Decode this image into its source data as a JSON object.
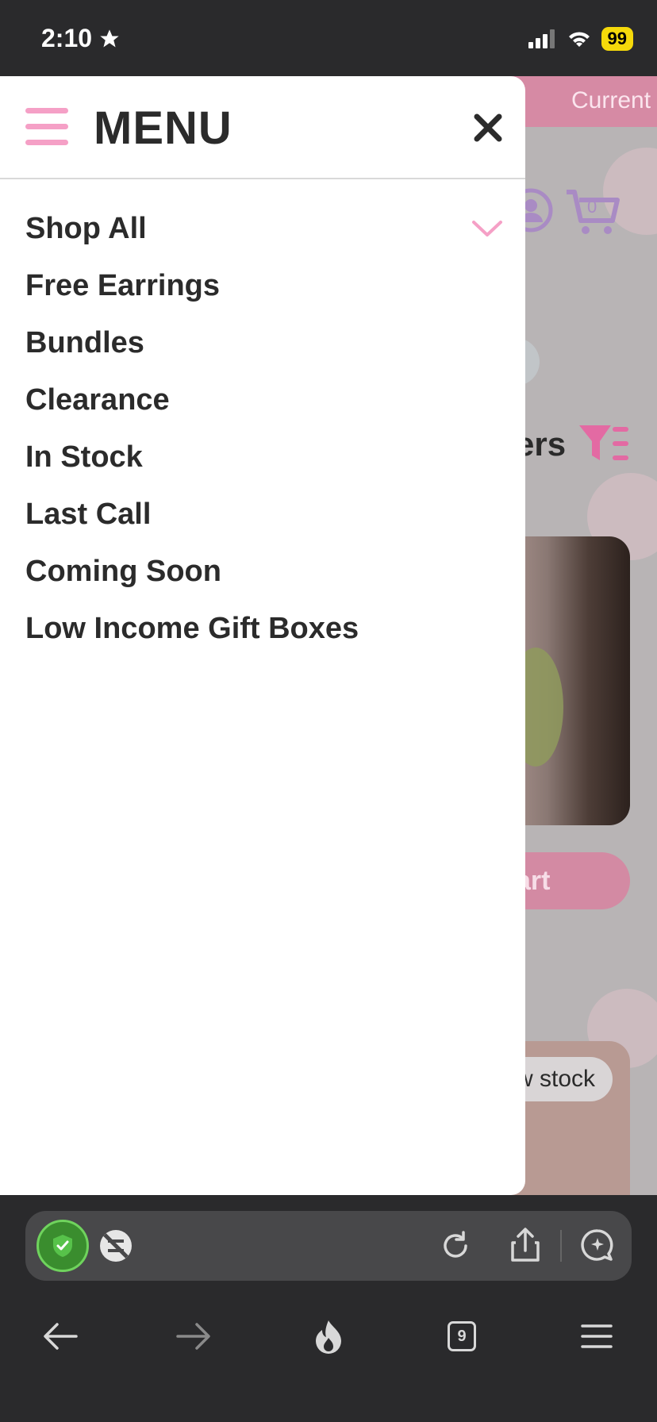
{
  "status_bar": {
    "time": "2:10",
    "battery": "99"
  },
  "background_page": {
    "promo_text": "Current",
    "cart_count": "0",
    "filter_text": "ers",
    "add_to_cart_label": "art",
    "badge_text": "w stock"
  },
  "menu": {
    "title": "MENU",
    "items": [
      {
        "label": "Shop All",
        "has_dropdown": true
      },
      {
        "label": "Free Earrings"
      },
      {
        "label": "Bundles"
      },
      {
        "label": "Clearance"
      },
      {
        "label": "In Stock"
      },
      {
        "label": "Last Call"
      },
      {
        "label": "Coming Soon"
      },
      {
        "label": "Low Income Gift Boxes"
      }
    ]
  },
  "browser": {
    "tab_count": "9"
  },
  "colors": {
    "accent_pink": "#f5a0c6",
    "text_dark": "#2b2b2b",
    "brand_purple": "#a98bc4"
  }
}
